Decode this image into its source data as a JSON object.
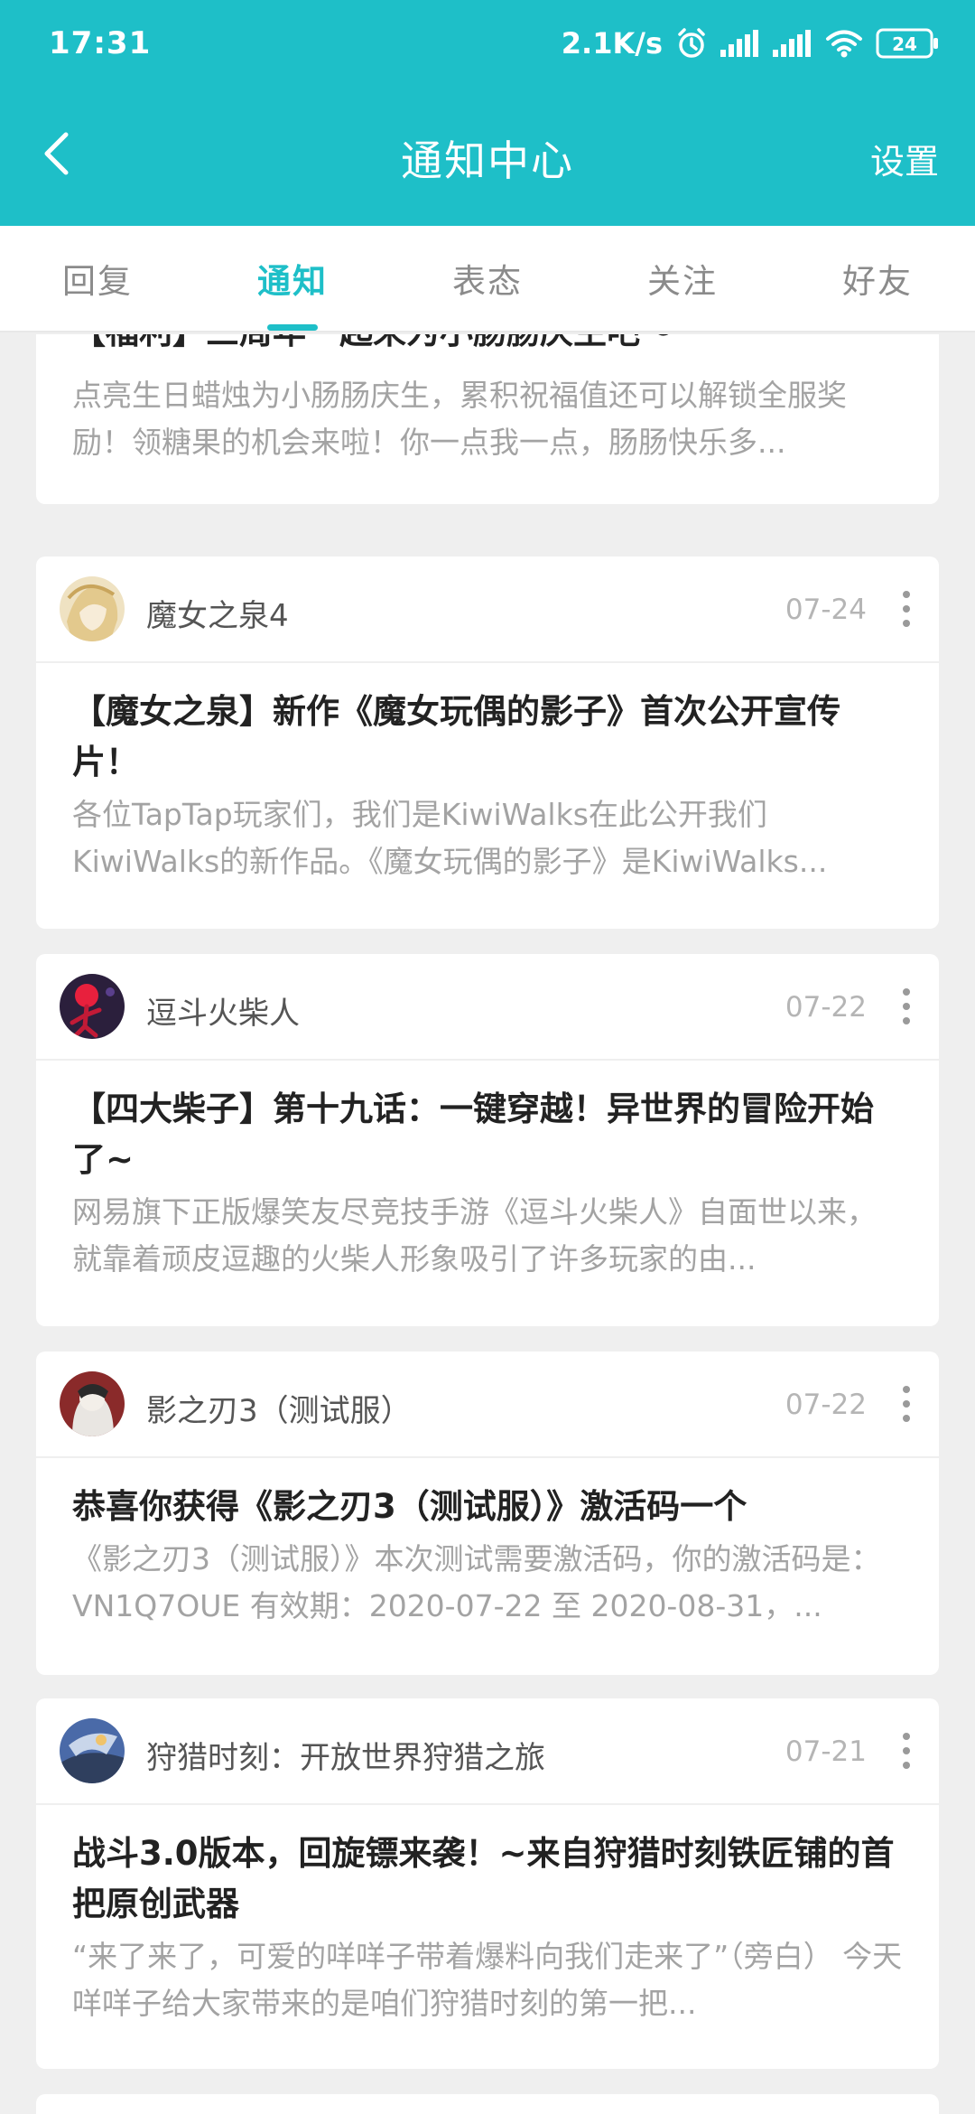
{
  "status_bar": {
    "time": "17:31",
    "net_speed": "2.1K/s",
    "battery": "24",
    "icons": [
      "alarm-icon",
      "signal-icon",
      "signal-icon",
      "wifi-icon",
      "battery-icon"
    ]
  },
  "header": {
    "title": "通知中心",
    "settings_label": "设置",
    "back_icon": "chevron-left-icon",
    "color": "#1ebfc8"
  },
  "tabs": [
    {
      "label": "回复",
      "active": false
    },
    {
      "label": "通知",
      "active": true
    },
    {
      "label": "表态",
      "active": false
    },
    {
      "label": "关注",
      "active": false
    },
    {
      "label": "好友",
      "active": false
    }
  ],
  "notifications": [
    {
      "author": "",
      "date": "",
      "title": "【福利】三周年一起来为小肠肠庆生吧～",
      "desc": "点亮生日蜡烛为小肠肠庆生，累积祝福值还可以解锁全服奖励！领糖果的机会来啦！你一点我一点，肠肠快乐多..."
    },
    {
      "author": "魔女之泉4",
      "date": "07-24",
      "title": "【魔女之泉】新作《魔女玩偶的影子》首次公开宣传片！",
      "desc": "各位TapTap玩家们，我们是KiwiWalks在此公开我们KiwiWalks的新作品。《魔女玩偶的影子》是KiwiWalks..."
    },
    {
      "author": "逗斗火柴人",
      "date": "07-22",
      "title": "【四大柴子】第十九话：一键穿越！异世界的冒险开始了~",
      "desc": "网易旗下正版爆笑友尽竞技手游《逗斗火柴人》自面世以来，就靠着顽皮逗趣的火柴人形象吸引了许多玩家的由..."
    },
    {
      "author": "影之刃3（测试服）",
      "date": "07-22",
      "title": "恭喜你获得《影之刃3（测试服）》激活码一个",
      "desc": "《影之刃3（测试服）》本次测试需要激活码，你的激活码是：VN1Q7OUE 有效期：2020-07-22 至 2020-08-31，..."
    },
    {
      "author": "狩猎时刻：开放世界狩猎之旅",
      "date": "07-21",
      "title": "战斗3.0版本，回旋镖来袭！~来自狩猎时刻铁匠铺的首把原创武器",
      "desc": "“来了来了，可爱的咩咩子带着爆料向我们走来了”（旁白） 今天咩咩子给大家带来的是咱们狩猎时刻的第一把..."
    }
  ]
}
